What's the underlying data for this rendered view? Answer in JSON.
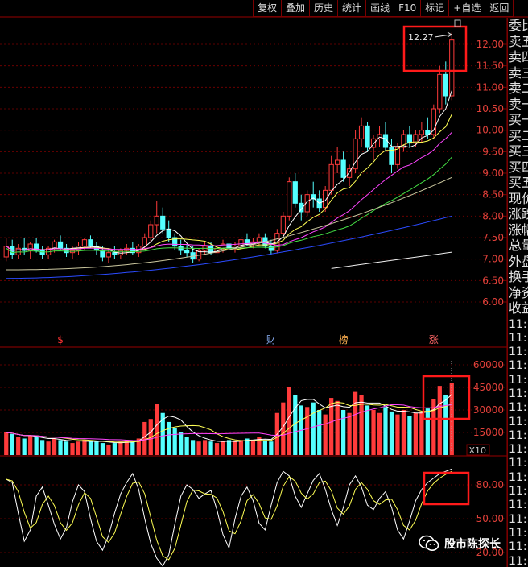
{
  "toolbar": {
    "buttons": [
      "复权",
      "叠加",
      "历史",
      "统计",
      "画线",
      "F10",
      "标记",
      "+自选",
      "返回"
    ]
  },
  "side_panel": {
    "labels": [
      "委比",
      "卖五",
      "卖四",
      "卖三",
      "卖二",
      "卖一",
      "买一",
      "买二",
      "买三",
      "买四",
      "买五",
      "现价",
      "涨跌",
      "涨幅",
      "总量",
      "外盘",
      "换手",
      "净资",
      "收益"
    ],
    "times": [
      "11:",
      "11:",
      "11:",
      "11:",
      "11:",
      "11:",
      "11:",
      "11:",
      "11:",
      "11:",
      "11:",
      "11:",
      "11:",
      "11:",
      "11:",
      "11:",
      "11:",
      "11:"
    ]
  },
  "price_panel": {
    "y_ticks": [
      "12.00",
      "11.50",
      "11.00",
      "10.50",
      "10.00",
      "9.50",
      "9.00",
      "8.50",
      "8.00",
      "7.50",
      "7.00",
      "6.50",
      "6.00"
    ],
    "high_label": "12.27",
    "event_markers": [
      "$",
      "财",
      "榜",
      "涨"
    ]
  },
  "volume_panel": {
    "y_ticks": [
      "60000",
      "45000",
      "30000",
      "15000"
    ],
    "unit_label": "X10"
  },
  "kdj_panel": {
    "y_ticks": [
      "80.00",
      "50.00",
      "20.00"
    ]
  },
  "watermark": {
    "text": "股市陈探长"
  },
  "colors": {
    "up": "#ff3b3b",
    "down": "#54ffff",
    "ma5": "#ffffff",
    "ma10": "#ffff55",
    "ma20": "#ff44ff",
    "ma30": "#44dd44",
    "ma60": "#ccc8a0",
    "ma120": "#2b4bff",
    "grid": "#7a0000",
    "highlight_box": "#ff1a1a"
  },
  "chart_data": {
    "type": "candlestick",
    "y_range_price": [
      5.75,
      12.35
    ],
    "y_range_volume": [
      0,
      68000
    ],
    "y_range_kdj": [
      0,
      105
    ],
    "candles": [
      [
        7.05,
        7.5,
        6.95,
        7.3
      ],
      [
        7.3,
        7.45,
        7.0,
        7.1
      ],
      [
        7.1,
        7.35,
        7.0,
        7.25
      ],
      [
        7.25,
        7.5,
        7.1,
        7.2
      ],
      [
        7.2,
        7.4,
        7.0,
        7.35
      ],
      [
        7.35,
        7.5,
        7.15,
        7.2
      ],
      [
        7.2,
        7.3,
        7.0,
        7.1
      ],
      [
        7.1,
        7.3,
        7.0,
        7.25
      ],
      [
        7.25,
        7.45,
        7.15,
        7.4
      ],
      [
        7.4,
        7.55,
        7.2,
        7.25
      ],
      [
        7.25,
        7.35,
        7.05,
        7.15
      ],
      [
        7.15,
        7.3,
        7.0,
        7.2
      ],
      [
        7.2,
        7.4,
        7.1,
        7.3
      ],
      [
        7.3,
        7.5,
        7.2,
        7.45
      ],
      [
        7.45,
        7.55,
        7.25,
        7.3
      ],
      [
        7.3,
        7.4,
        7.1,
        7.2
      ],
      [
        7.2,
        7.3,
        6.95,
        7.05
      ],
      [
        7.05,
        7.2,
        6.9,
        7.15
      ],
      [
        7.15,
        7.3,
        7.0,
        7.1
      ],
      [
        7.1,
        7.25,
        7.0,
        7.2
      ],
      [
        7.2,
        7.35,
        7.1,
        7.25
      ],
      [
        7.25,
        7.4,
        7.1,
        7.15
      ],
      [
        7.15,
        7.35,
        7.05,
        7.3
      ],
      [
        7.3,
        7.6,
        7.2,
        7.5
      ],
      [
        7.5,
        7.9,
        7.4,
        7.8
      ],
      [
        7.8,
        8.35,
        7.6,
        8.0
      ],
      [
        8.0,
        8.2,
        7.6,
        7.7
      ],
      [
        7.7,
        7.9,
        7.4,
        7.5
      ],
      [
        7.5,
        7.6,
        7.2,
        7.3
      ],
      [
        7.3,
        7.45,
        7.1,
        7.2
      ],
      [
        7.2,
        7.35,
        7.05,
        7.15
      ],
      [
        7.15,
        7.3,
        6.9,
        7.0
      ],
      [
        7.0,
        7.25,
        6.95,
        7.2
      ],
      [
        7.2,
        7.4,
        7.1,
        7.3
      ],
      [
        7.3,
        7.4,
        7.1,
        7.15
      ],
      [
        7.15,
        7.3,
        7.05,
        7.25
      ],
      [
        7.25,
        7.45,
        7.15,
        7.35
      ],
      [
        7.35,
        7.5,
        7.2,
        7.25
      ],
      [
        7.25,
        7.4,
        7.15,
        7.3
      ],
      [
        7.3,
        7.5,
        7.2,
        7.45
      ],
      [
        7.45,
        7.6,
        7.3,
        7.35
      ],
      [
        7.35,
        7.5,
        7.25,
        7.4
      ],
      [
        7.4,
        7.6,
        7.3,
        7.5
      ],
      [
        7.5,
        7.6,
        7.25,
        7.3
      ],
      [
        7.3,
        7.45,
        7.1,
        7.2
      ],
      [
        7.2,
        7.7,
        7.15,
        7.6
      ],
      [
        7.6,
        8.1,
        7.5,
        8.0
      ],
      [
        8.0,
        8.9,
        7.9,
        8.8
      ],
      [
        8.8,
        9.0,
        8.2,
        8.3
      ],
      [
        8.3,
        8.5,
        7.9,
        8.1
      ],
      [
        8.1,
        8.6,
        8.0,
        8.5
      ],
      [
        8.5,
        8.8,
        8.2,
        8.4
      ],
      [
        8.4,
        8.6,
        8.1,
        8.2
      ],
      [
        8.2,
        8.7,
        8.1,
        8.6
      ],
      [
        8.6,
        9.4,
        8.5,
        9.2
      ],
      [
        9.2,
        9.6,
        9.0,
        9.3
      ],
      [
        9.3,
        9.5,
        8.8,
        8.9
      ],
      [
        8.9,
        9.2,
        8.7,
        9.1
      ],
      [
        9.1,
        10.0,
        9.0,
        9.8
      ],
      [
        9.8,
        10.3,
        9.6,
        10.1
      ],
      [
        10.1,
        10.2,
        9.5,
        9.6
      ],
      [
        9.6,
        9.9,
        9.3,
        9.8
      ],
      [
        9.8,
        10.1,
        9.6,
        9.9
      ],
      [
        9.9,
        10.2,
        9.5,
        9.6
      ],
      [
        9.6,
        9.8,
        9.0,
        9.2
      ],
      [
        9.2,
        9.7,
        9.1,
        9.6
      ],
      [
        9.6,
        10.0,
        9.5,
        9.9
      ],
      [
        9.9,
        10.1,
        9.6,
        9.7
      ],
      [
        9.7,
        10.0,
        9.6,
        9.9
      ],
      [
        9.9,
        10.2,
        9.7,
        10.0
      ],
      [
        10.0,
        10.3,
        9.8,
        9.9
      ],
      [
        9.9,
        10.6,
        9.8,
        10.5
      ],
      [
        10.5,
        11.5,
        10.4,
        11.3
      ],
      [
        11.3,
        11.6,
        10.6,
        10.8
      ],
      [
        10.8,
        12.27,
        10.7,
        12.1
      ]
    ],
    "volume": [
      15000,
      14000,
      12000,
      11000,
      13000,
      12000,
      10000,
      9000,
      11000,
      10000,
      9000,
      8000,
      9000,
      10000,
      9500,
      9000,
      8000,
      7000,
      8000,
      9000,
      10000,
      9000,
      11000,
      22000,
      24000,
      34000,
      28000,
      22000,
      18000,
      15000,
      12000,
      10000,
      9000,
      10000,
      9000,
      8000,
      9000,
      10000,
      9000,
      10000,
      11000,
      10000,
      12000,
      10000,
      9000,
      28000,
      35000,
      45000,
      40000,
      33000,
      32000,
      35000,
      30000,
      27000,
      38000,
      36000,
      30000,
      28000,
      42000,
      40000,
      33000,
      30000,
      28000,
      32000,
      29000,
      27000,
      30000,
      26000,
      28000,
      29000,
      31000,
      37000,
      46000,
      40000,
      48000
    ],
    "kdj_k": [
      85,
      82,
      55,
      30,
      40,
      70,
      78,
      62,
      45,
      32,
      42,
      65,
      80,
      74,
      50,
      30,
      22,
      35,
      55,
      72,
      82,
      90,
      76,
      50,
      28,
      15,
      8,
      18,
      45,
      70,
      80,
      76,
      68,
      72,
      75,
      58,
      36,
      24,
      50,
      70,
      78,
      66,
      46,
      40,
      62,
      82,
      92,
      88,
      70,
      60,
      72,
      84,
      90,
      76,
      58,
      44,
      60,
      80,
      88,
      78,
      62,
      58,
      68,
      74,
      60,
      40,
      32,
      48,
      66,
      76,
      82,
      86,
      90,
      92,
      94
    ]
  }
}
